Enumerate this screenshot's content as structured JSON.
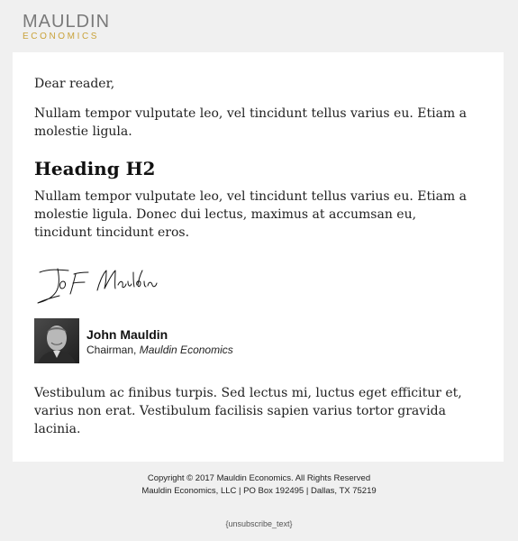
{
  "header": {
    "logo_main": "MAULDIN",
    "logo_sub": "ECONOMICS",
    "logo_main_color": "#7a7a7a",
    "logo_sub_color": "#c9a23a"
  },
  "body": {
    "greeting": "Dear reader,",
    "paragraph_1": "Nullam tempor vulputate leo, vel tincidunt tellus varius eu. Etiam a molestie ligula.",
    "heading": "Heading H2",
    "paragraph_2": "Nullam tempor vulputate leo, vel tincidunt tellus varius eu. Etiam a molestie ligula. Donec dui lectus, maximus at accumsan eu, tincidunt tincidunt eros.",
    "paragraph_3": "Vestibulum ac finibus turpis. Sed lectus mi, luctus eget efficitur et, varius non erat. Vestibulum facilisis sapien varius tortor gravida lacinia."
  },
  "author": {
    "name": "John Mauldin",
    "title": "Chairman,",
    "company": "Mauldin Economics",
    "signature": "John Mauldin"
  },
  "footer": {
    "copyright": "Copyright © 2017 Mauldin Economics. All Rights Reserved",
    "address": "Mauldin Economics, LLC | PO Box 192495 | Dallas, TX 75219",
    "unsubscribe": "{unsubscribe_text}"
  },
  "colors": {
    "page_background": "#f0f0f0",
    "card_background": "#ffffff",
    "text": "#222222"
  }
}
